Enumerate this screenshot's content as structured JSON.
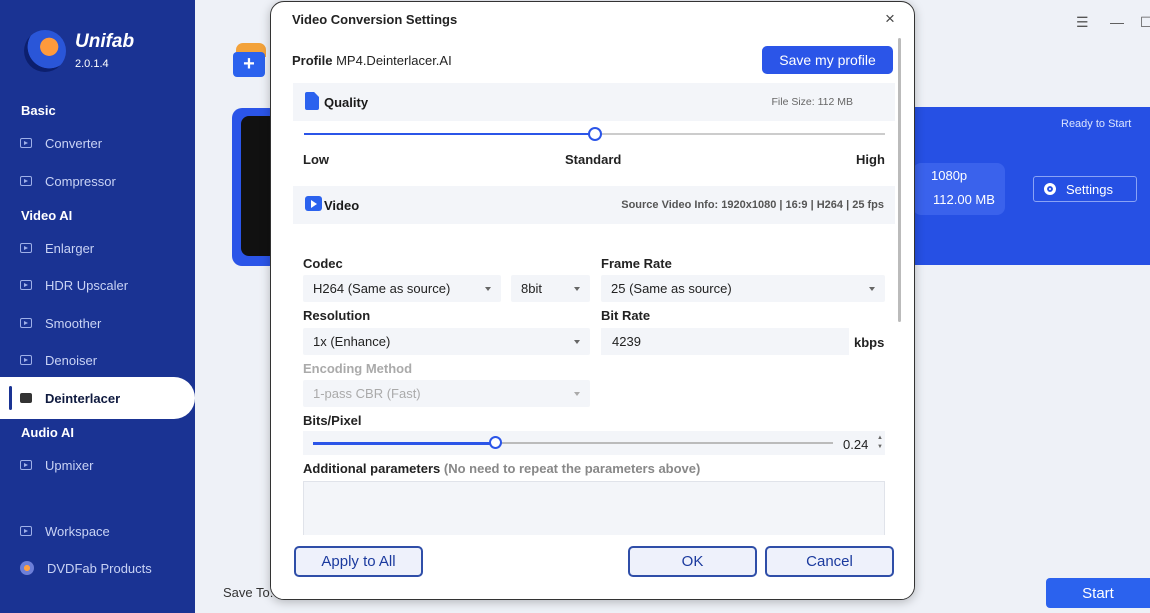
{
  "app": {
    "name": "Unifab",
    "version": "2.0.1.4"
  },
  "sidebar": {
    "sections": {
      "basic": "Basic",
      "video_ai": "Video AI",
      "audio_ai": "Audio AI"
    },
    "items": {
      "converter": "Converter",
      "compressor": "Compressor",
      "enlarger": "Enlarger",
      "hdr_upscaler": "HDR Upscaler",
      "smoother": "Smoother",
      "denoiser": "Denoiser",
      "deinterlacer": "Deinterlacer",
      "upmixer": "Upmixer",
      "workspace": "Workspace",
      "dvdfab_products": "DVDFab Products"
    },
    "active_item": "Deinterlacer"
  },
  "background": {
    "add_label": "+",
    "ready_text": "Ready to Start",
    "resolution": "1080p",
    "size": "112.00 MB",
    "settings_label": "Settings",
    "save_to_label": "Save To:",
    "start_label": "Start"
  },
  "dialog": {
    "title": "Video Conversion Settings",
    "close_glyph": "×",
    "profile_label": "Profile",
    "profile_value": "MP4.Deinterlacer.AI",
    "save_profile_label": "Save my profile",
    "quality": {
      "title": "Quality",
      "file_size": "File Size:  112 MB",
      "low": "Low",
      "standard": "Standard",
      "high": "High",
      "level_fraction": 0.5
    },
    "video": {
      "title": "Video",
      "source_info": "Source Video Info: 1920x1080 | 16:9 | H264 | 25 fps"
    },
    "codec": {
      "label": "Codec",
      "value": "H264 (Same as source)",
      "bitdepth": "8bit"
    },
    "frame_rate": {
      "label": "Frame Rate",
      "value": "25 (Same as source)"
    },
    "resolution": {
      "label": "Resolution",
      "value": "1x (Enhance)"
    },
    "bit_rate": {
      "label": "Bit Rate",
      "value": "4239",
      "unit": "kbps"
    },
    "encoding": {
      "label": "Encoding Method",
      "value": "1-pass CBR (Fast)"
    },
    "bits_pixel": {
      "label": "Bits/Pixel",
      "value": "0.24",
      "level_fraction": 0.35
    },
    "additional": {
      "label": "Additional parameters",
      "note": "(No need to repeat the parameters above)"
    },
    "buttons": {
      "apply_all": "Apply to All",
      "ok": "OK",
      "cancel": "Cancel"
    }
  }
}
